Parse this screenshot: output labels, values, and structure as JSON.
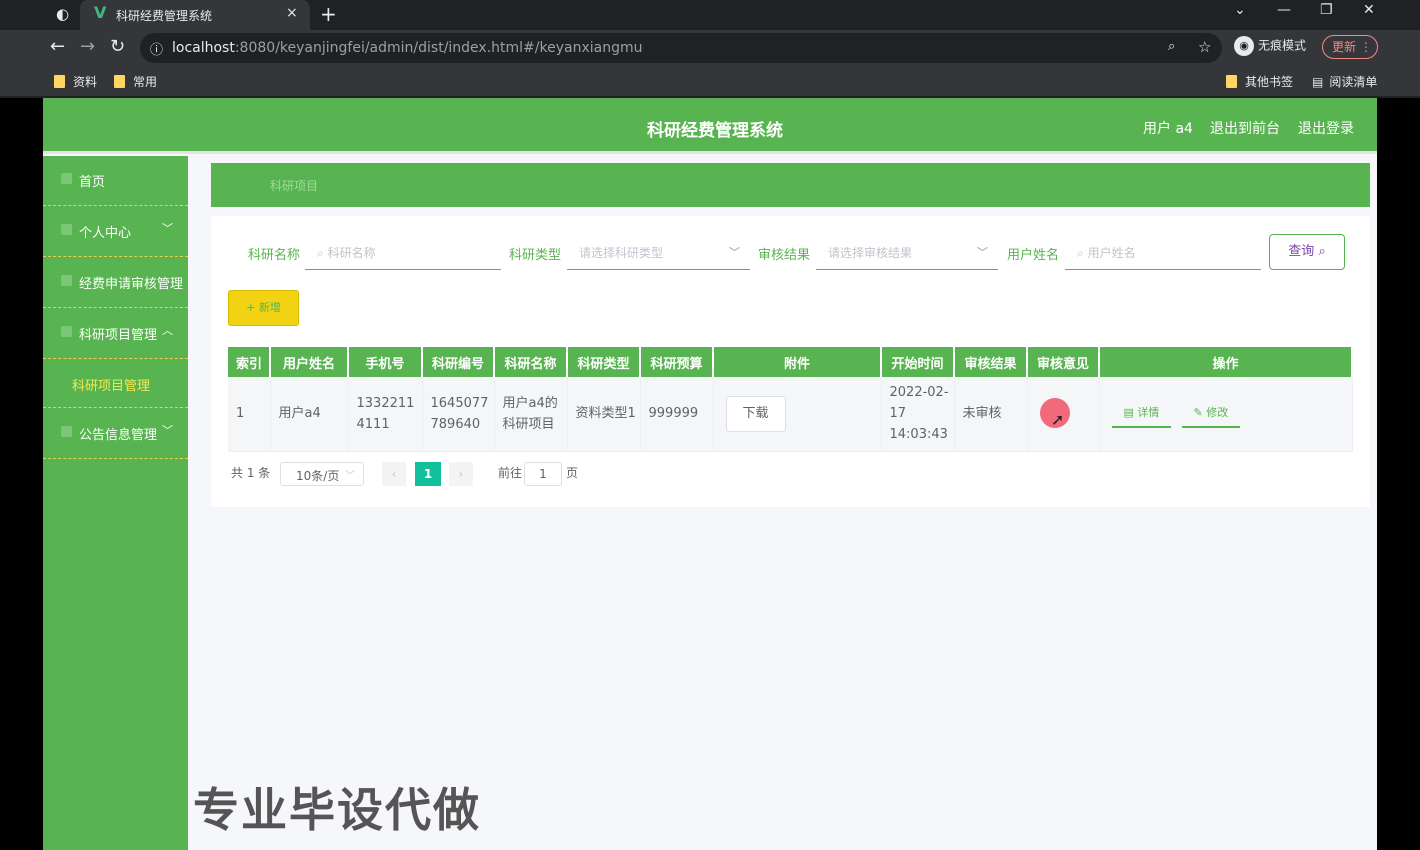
{
  "browser": {
    "tab_title": "科研经费管理系统",
    "tab_close": "×",
    "new_tab": "+",
    "url_host": "localhost",
    "url_rest": ":8080/keyanjingfei/admin/dist/index.html#/keyanxiangmu",
    "incognito_label": "无痕模式",
    "update_label": "更新",
    "bookmarks": [
      "资料",
      "常用"
    ],
    "bookmarks_right": [
      "其他书签",
      "阅读清单"
    ]
  },
  "header": {
    "title": "科研经费管理系统",
    "user": "用户 a4",
    "to_front": "退出到前台",
    "logout": "退出登录"
  },
  "sidebar": {
    "items": [
      {
        "label": "首页"
      },
      {
        "label": "个人中心"
      },
      {
        "label": "经费申请审核管理"
      },
      {
        "label": "科研项目管理"
      },
      {
        "label": "科研项目管理"
      },
      {
        "label": "公告信息管理"
      }
    ]
  },
  "breadcrumb": "科研项目",
  "filters": {
    "name_label": "科研名称",
    "name_placeholder": "科研名称",
    "type_label": "科研类型",
    "type_placeholder": "请选择科研类型",
    "result_label": "审核结果",
    "result_placeholder": "请选择审核结果",
    "user_label": "用户姓名",
    "user_placeholder": "用户姓名",
    "query_button": "查询",
    "add_button": "+ 新增"
  },
  "table": {
    "headers": [
      "索引",
      "用户姓名",
      "手机号",
      "科研编号",
      "科研名称",
      "科研类型",
      "科研预算",
      "附件",
      "开始时间",
      "审核结果",
      "审核意见",
      "操作"
    ],
    "rows": [
      {
        "index": "1",
        "user": "用户a4",
        "phone": "13322114111",
        "code": "1645077789640",
        "name": "用户a4的科研项目",
        "type": "资料类型1",
        "budget": "999999",
        "attachment": "下载",
        "start": "2022-02-17 14:03:43",
        "result": "未审核",
        "opinion": "",
        "detail": "详情",
        "edit": "修改"
      }
    ]
  },
  "pagination": {
    "total": "共 1 条",
    "page_size": "10条/页",
    "current": "1",
    "goto": "前往",
    "goto_value": "1",
    "page_unit": "页"
  },
  "watermark": "专业毕设代做"
}
